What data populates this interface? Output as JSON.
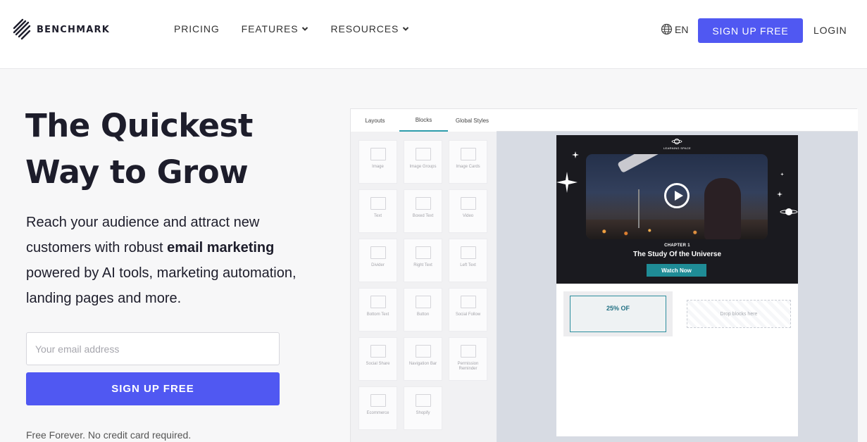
{
  "header": {
    "brand": "BENCHMARK",
    "nav": [
      {
        "label": "PRICING",
        "dropdown": false
      },
      {
        "label": "FEATURES",
        "dropdown": true
      },
      {
        "label": "RESOURCES",
        "dropdown": true
      }
    ],
    "language": "EN",
    "signup_label": "SIGN UP FREE",
    "login_label": "LOGIN"
  },
  "hero": {
    "title_line1": "The Quickest",
    "title_line2": "Way to Grow",
    "sub_part1": "Reach your audience and attract new customers with robust ",
    "sub_bold": "email marketing",
    "sub_part2": " powered by AI tools, marketing automation, landing pages and more.",
    "email_placeholder": "Your email address",
    "signup_label": "SIGN UP FREE",
    "fineprint": "Free Forever. No credit card required."
  },
  "editor": {
    "tabs": [
      {
        "label": "Layouts",
        "active": false
      },
      {
        "label": "Blocks",
        "active": true
      },
      {
        "label": "Global Styles",
        "active": false
      }
    ],
    "blocks": [
      "Image",
      "Image Groups",
      "Image Cards",
      "Text",
      "Boxed Text",
      "Video",
      "Divider",
      "Right Text",
      "Left Text",
      "Bottom Text",
      "Button",
      "Social Follow",
      "Social Share",
      "Navigation Bar",
      "Permission Reminder",
      "Ecommerce",
      "Shopify"
    ],
    "email": {
      "brand_label": "LEARNING SPACE",
      "chapter": "CHAPTER 1",
      "heading": "The Study Of the Universe",
      "cta": "Watch Now",
      "promo": "25% OF",
      "drop_hint": "Drop blocks here"
    }
  },
  "colors": {
    "accent": "#5058f2",
    "teal": "#1f8c96",
    "canvas": "#d7dbe3"
  }
}
